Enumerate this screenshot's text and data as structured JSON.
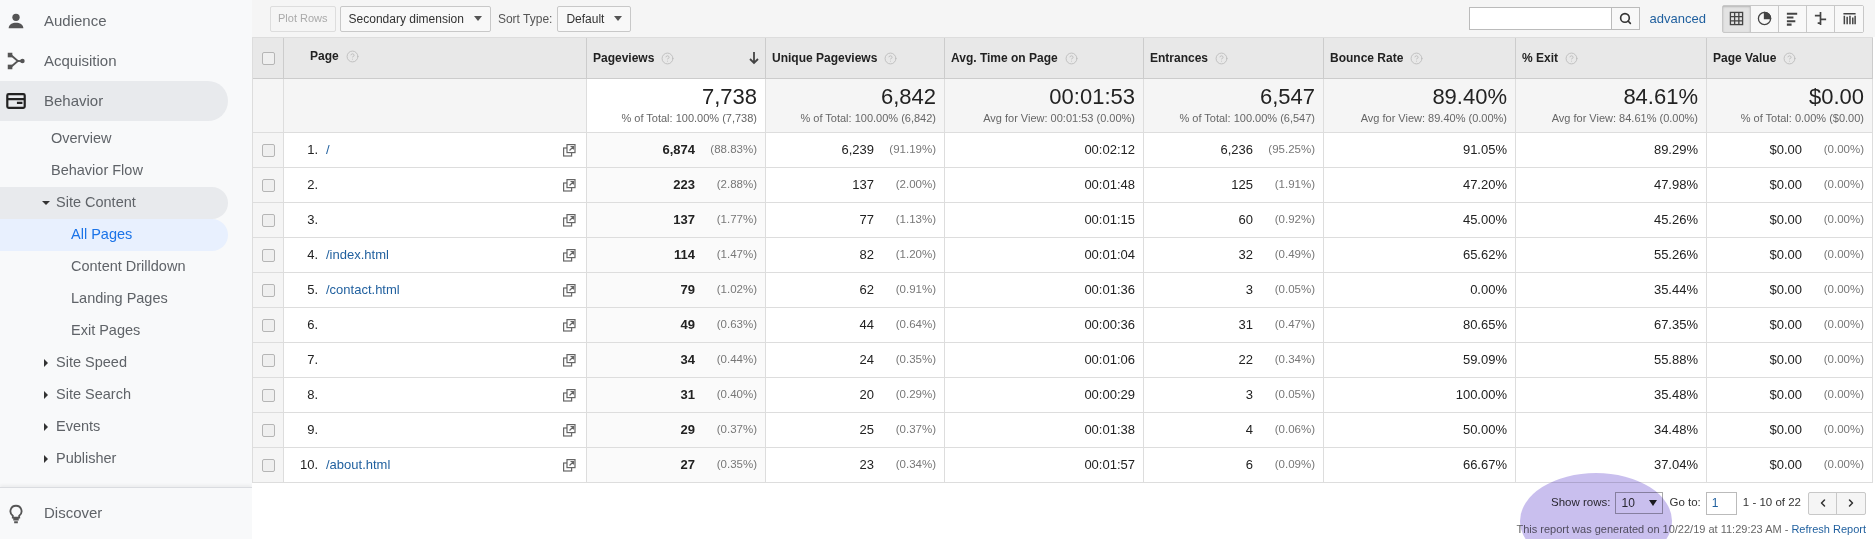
{
  "sidebar": {
    "items": [
      {
        "label": "Audience",
        "kind": "person",
        "expanded": false,
        "selected": false
      },
      {
        "label": "Acquisition",
        "kind": "branch",
        "expanded": false,
        "selected": false
      },
      {
        "label": "Behavior",
        "kind": "card",
        "expanded": true,
        "selected": false,
        "children": [
          {
            "label": "Overview",
            "selected": false
          },
          {
            "label": "Behavior Flow",
            "selected": false
          },
          {
            "label": "Site Content",
            "expanded": true,
            "selected": false,
            "children": [
              {
                "label": "All Pages",
                "selected": true
              },
              {
                "label": "Content Drilldown",
                "selected": false
              },
              {
                "label": "Landing Pages",
                "selected": false
              },
              {
                "label": "Exit Pages",
                "selected": false
              }
            ]
          },
          {
            "label": "Site Speed",
            "expanded": false,
            "selected": false
          },
          {
            "label": "Site Search",
            "expanded": false,
            "selected": false
          },
          {
            "label": "Events",
            "expanded": false,
            "selected": false
          },
          {
            "label": "Publisher",
            "expanded": false,
            "selected": false
          }
        ]
      }
    ],
    "footer_item": {
      "label": "Discover",
      "kind": "bulb"
    }
  },
  "toolbar": {
    "plot_rows": {
      "label": "Plot Rows",
      "disabled": true
    },
    "secondary_dimension": "Secondary dimension",
    "sort_type_label": "Sort Type:",
    "sort_type": "Default",
    "advanced": "advanced",
    "views": [
      {
        "kind": "table",
        "selected": true
      },
      {
        "kind": "pie",
        "selected": false
      },
      {
        "kind": "bars",
        "selected": false
      },
      {
        "kind": "comparison",
        "selected": false
      },
      {
        "kind": "cloud",
        "selected": false
      }
    ]
  },
  "table": {
    "header_checked": false,
    "columns": [
      {
        "label": "Page",
        "sorted": false
      },
      {
        "label": "Pageviews",
        "sorted": true
      },
      {
        "label": "Unique Pageviews",
        "sorted": false
      },
      {
        "label": "Avg. Time on Page",
        "sorted": false
      },
      {
        "label": "Entrances",
        "sorted": false
      },
      {
        "label": "Bounce Rate",
        "sorted": false
      },
      {
        "label": "% Exit",
        "sorted": false
      },
      {
        "label": "Page Value",
        "sorted": false
      }
    ],
    "totals": [
      {
        "value": "7,738",
        "note": "% of Total: 100.00% (7,738)"
      },
      {
        "value": "6,842",
        "note": "% of Total: 100.00% (6,842)"
      },
      {
        "value": "00:01:53",
        "note": "Avg for View: 00:01:53 (0.00%)"
      },
      {
        "value": "6,547",
        "note": "% of Total: 100.00% (6,547)"
      },
      {
        "value": "89.40%",
        "note": "Avg for View: 89.40% (0.00%)"
      },
      {
        "value": "84.61%",
        "note": "Avg for View: 84.61% (0.00%)"
      },
      {
        "value": "$0.00",
        "note": "% of Total: 0.00% ($0.00)"
      }
    ],
    "rows": [
      {
        "checked": false,
        "index": "1.",
        "page": "/",
        "pageviews": "6,874",
        "pageviews_pct": "(88.83%)",
        "unique": "6,239",
        "unique_pct": "(91.19%)",
        "avg_time": "00:02:12",
        "entrances": "6,236",
        "entrances_pct": "(95.25%)",
        "bounce": "91.05%",
        "exit": "89.29%",
        "value": "$0.00",
        "value_pct": "(0.00%)"
      },
      {
        "checked": false,
        "index": "2.",
        "pageviews": "223",
        "pageviews_pct": "(2.88%)",
        "unique": "137",
        "unique_pct": "(2.00%)",
        "avg_time": "00:01:48",
        "entrances": "125",
        "entrances_pct": "(1.91%)",
        "bounce": "47.20%",
        "exit": "47.98%",
        "value": "$0.00",
        "value_pct": "(0.00%)"
      },
      {
        "checked": false,
        "index": "3.",
        "pageviews": "137",
        "pageviews_pct": "(1.77%)",
        "unique": "77",
        "unique_pct": "(1.13%)",
        "avg_time": "00:01:15",
        "entrances": "60",
        "entrances_pct": "(0.92%)",
        "bounce": "45.00%",
        "exit": "45.26%",
        "value": "$0.00",
        "value_pct": "(0.00%)"
      },
      {
        "checked": false,
        "index": "4.",
        "page": "/index.html",
        "pageviews": "114",
        "pageviews_pct": "(1.47%)",
        "unique": "82",
        "unique_pct": "(1.20%)",
        "avg_time": "00:01:04",
        "entrances": "32",
        "entrances_pct": "(0.49%)",
        "bounce": "65.62%",
        "exit": "55.26%",
        "value": "$0.00",
        "value_pct": "(0.00%)"
      },
      {
        "checked": false,
        "index": "5.",
        "page": "/contact.html",
        "pageviews": "79",
        "pageviews_pct": "(1.02%)",
        "unique": "62",
        "unique_pct": "(0.91%)",
        "avg_time": "00:01:36",
        "entrances": "3",
        "entrances_pct": "(0.05%)",
        "bounce": "0.00%",
        "exit": "35.44%",
        "value": "$0.00",
        "value_pct": "(0.00%)"
      },
      {
        "checked": false,
        "index": "6.",
        "pageviews": "49",
        "pageviews_pct": "(0.63%)",
        "unique": "44",
        "unique_pct": "(0.64%)",
        "avg_time": "00:00:36",
        "entrances": "31",
        "entrances_pct": "(0.47%)",
        "bounce": "80.65%",
        "exit": "67.35%",
        "value": "$0.00",
        "value_pct": "(0.00%)"
      },
      {
        "checked": false,
        "index": "7.",
        "pageviews": "34",
        "pageviews_pct": "(0.44%)",
        "unique": "24",
        "unique_pct": "(0.35%)",
        "avg_time": "00:01:06",
        "entrances": "22",
        "entrances_pct": "(0.34%)",
        "bounce": "59.09%",
        "exit": "55.88%",
        "value": "$0.00",
        "value_pct": "(0.00%)"
      },
      {
        "checked": false,
        "index": "8.",
        "pageviews": "31",
        "pageviews_pct": "(0.40%)",
        "unique": "20",
        "unique_pct": "(0.29%)",
        "avg_time": "00:00:29",
        "entrances": "3",
        "entrances_pct": "(0.05%)",
        "bounce": "100.00%",
        "exit": "35.48%",
        "value": "$0.00",
        "value_pct": "(0.00%)"
      },
      {
        "checked": false,
        "index": "9.",
        "pageviews": "29",
        "pageviews_pct": "(0.37%)",
        "unique": "25",
        "unique_pct": "(0.37%)",
        "avg_time": "00:01:38",
        "entrances": "4",
        "entrances_pct": "(0.06%)",
        "bounce": "50.00%",
        "exit": "34.48%",
        "value": "$0.00",
        "value_pct": "(0.00%)"
      },
      {
        "checked": false,
        "index": "10.",
        "page": "/about.html",
        "pageviews": "27",
        "pageviews_pct": "(0.35%)",
        "unique": "23",
        "unique_pct": "(0.34%)",
        "avg_time": "00:01:57",
        "entrances": "6",
        "entrances_pct": "(0.09%)",
        "bounce": "66.67%",
        "exit": "37.04%",
        "value": "$0.00",
        "value_pct": "(0.00%)"
      }
    ]
  },
  "pagination": {
    "show_rows_label": "Show rows:",
    "show_rows": "10",
    "go_to_label": "Go to:",
    "go_to": "1",
    "range": "1 - 10 of 22"
  },
  "report": {
    "text": "This report was generated on 10/22/19 at 11:29:23 AM - ",
    "link": "Refresh Report"
  }
}
